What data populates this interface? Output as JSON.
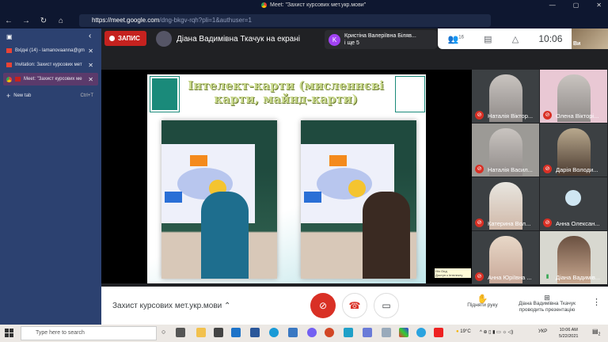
{
  "window": {
    "title": "Meet: \"Захист курсових мет.укр.мови\"",
    "controls": [
      "—",
      "▢",
      "✕"
    ]
  },
  "browser": {
    "url_host": "https://meet.google.com",
    "url_path": "/dng-bkgv-rqh?pli=1&authuser=1",
    "nav": [
      "←",
      "→",
      "↻",
      "⌂"
    ]
  },
  "sidebar": {
    "tabs": [
      {
        "label": "Вхідні (14) - lamanovaanna@gm"
      },
      {
        "label": "Invitation: Захист курсових мет"
      },
      {
        "label": "Meet: \"Захист курсових ме"
      }
    ],
    "new_tab": {
      "label": "New tab",
      "shortcut": "Ctrl+T"
    }
  },
  "meet": {
    "record_label": "ЗАПИС",
    "presenter_banner": "Діана Вадимівна Ткачук на екрані",
    "chip": {
      "initial": "K",
      "name": "Кристіна Валеріївна Біляв...",
      "more": "і ще 5"
    },
    "participants_count": "16",
    "clock": "10:06",
    "self_label": "Ви",
    "slide": {
      "title": "Інтелект-карти (мисленнєві карти, майнд-карти)"
    },
    "tooltip": [
      "Ніч Олд",
      "Доступ к Інтелекту"
    ],
    "tiles": [
      {
        "name": "Наталія Віктор..."
      },
      {
        "name": "Олена Вікторі..."
      },
      {
        "name": "Наталія Васил..."
      },
      {
        "name": "Дарія Володи..."
      },
      {
        "name": "Катерина Вол..."
      },
      {
        "name": "Анна Олексан..."
      },
      {
        "name": "Анна Юріївна ..."
      },
      {
        "name": "Діана Вадимів..."
      }
    ],
    "meeting_name": "Захист курсових мет.укр.мови",
    "raise_hand": "Підняти руку",
    "presenting": [
      "Діана Вадимівна Ткачук",
      "проводить презентацію"
    ]
  },
  "taskbar": {
    "search_placeholder": "Type here to search",
    "weather": "19°C",
    "lang": "УКР",
    "time": "10:06 AM",
    "date": "5/22/2021",
    "notif": "2"
  },
  "colors": {
    "record": "#c5221f",
    "mic_off": "#d93025",
    "sidebar": "#2c4170"
  }
}
